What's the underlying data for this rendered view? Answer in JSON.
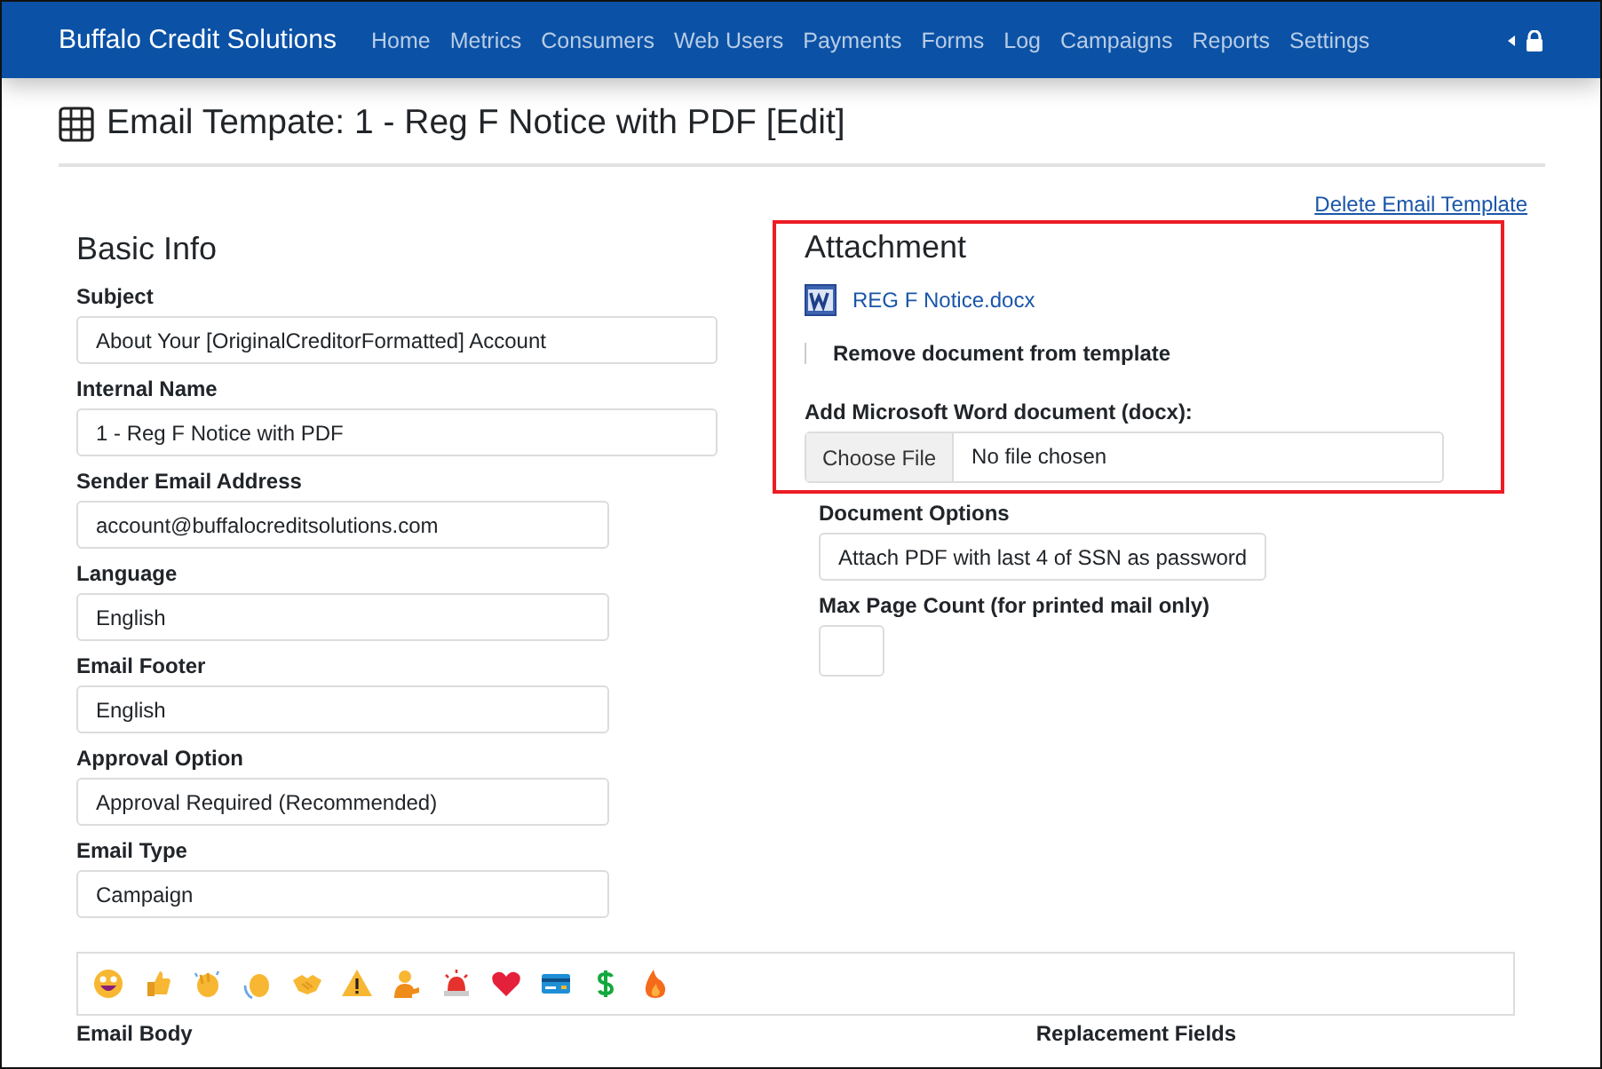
{
  "navbar": {
    "brand": "Buffalo Credit Solutions",
    "items": [
      {
        "label": "Home"
      },
      {
        "label": "Metrics"
      },
      {
        "label": "Consumers"
      },
      {
        "label": "Web Users"
      },
      {
        "label": "Payments"
      },
      {
        "label": "Forms"
      },
      {
        "label": "Log"
      },
      {
        "label": "Campaigns"
      },
      {
        "label": "Reports"
      },
      {
        "label": "Settings"
      }
    ]
  },
  "page": {
    "title": "Email Tempate: 1 - Reg F Notice with PDF [Edit]",
    "delete_link": "Delete Email Template"
  },
  "basic_info": {
    "heading": "Basic Info",
    "fields": [
      {
        "label": "Subject",
        "value": "About Your [OriginalCreditorFormatted] Account",
        "kind": "wide"
      },
      {
        "label": "Internal Name",
        "value": "1 - Reg F Notice with PDF",
        "kind": "wide"
      },
      {
        "label": "Sender Email Address",
        "value": "account@buffalocreditsolutions.com",
        "kind": "narrow"
      },
      {
        "label": "Language",
        "value": "English",
        "kind": "narrow"
      },
      {
        "label": "Email Footer",
        "value": "English",
        "kind": "narrow"
      },
      {
        "label": "Approval Option",
        "value": "Approval Required (Recommended)",
        "kind": "narrow"
      },
      {
        "label": "Email Type",
        "value": "Campaign",
        "kind": "narrow"
      }
    ]
  },
  "attachment": {
    "heading": "Attachment",
    "file_name": "REG F Notice.docx",
    "remove_label": "Remove document from template",
    "remove_checked": false,
    "upload_label": "Add Microsoft Word document (docx):",
    "choose_button": "Choose File",
    "no_file": "No file chosen"
  },
  "document_options": {
    "label": "Document Options",
    "value": "Attach PDF with last 4 of SSN as password"
  },
  "max_page_count": {
    "label": "Max Page Count (for printed mail only)"
  },
  "bottom": {
    "email_body_label": "Email Body",
    "replacement_fields_label": "Replacement Fields"
  }
}
